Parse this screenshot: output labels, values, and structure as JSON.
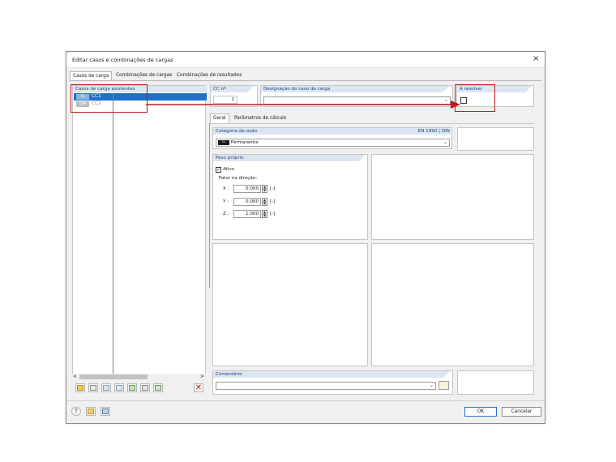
{
  "window": {
    "title": "Editar casos e combinações de cargas",
    "close_glyph": "×"
  },
  "tabs": [
    {
      "label": "Casos de carga",
      "selected": true
    },
    {
      "label": "Combinações de cargas",
      "selected": false
    },
    {
      "label": "Combinações de resultados",
      "selected": false
    }
  ],
  "left": {
    "header": "Casos de carga existentes",
    "items": [
      {
        "badge": "G",
        "label": "CC1",
        "selected": true,
        "color": "#1c70c8"
      },
      {
        "badge": "QiA",
        "label": "CC2",
        "selected": false,
        "color": "#9aa0a6"
      }
    ],
    "scroll_left": "<",
    "scroll_right": ">"
  },
  "top": {
    "cc_header": "CC nº",
    "cc_value": "1",
    "name_header": "Designação do caso de carga",
    "name_value": "",
    "resolve_header": "A resolver"
  },
  "subtabs": [
    {
      "label": "Geral",
      "selected": true
    },
    {
      "label": "Parâmetros de cálculo",
      "selected": false
    }
  ],
  "action": {
    "header": "Categoria de ação",
    "norm": "EN 1990 | DIN",
    "badge": "G",
    "value": "Permanente"
  },
  "selfweight": {
    "header": "Peso próprio",
    "active_label": "Ativo",
    "active_checked": true,
    "factor_label": "Fator na direção:",
    "rows": [
      {
        "axis": "X :",
        "value": "0.000",
        "unit": "[-]"
      },
      {
        "axis": "Y :",
        "value": "0.000",
        "unit": "[-]"
      },
      {
        "axis": "Z :",
        "value": "1.000",
        "unit": "[-]"
      }
    ]
  },
  "comment": {
    "header": "Comentário",
    "value": ""
  },
  "buttons": {
    "ok": "OK",
    "cancel": "Cancelar"
  },
  "colors": {
    "accent": "#1c70c8",
    "header_bg": "#dce6f2",
    "highlight": "#c0191f"
  }
}
